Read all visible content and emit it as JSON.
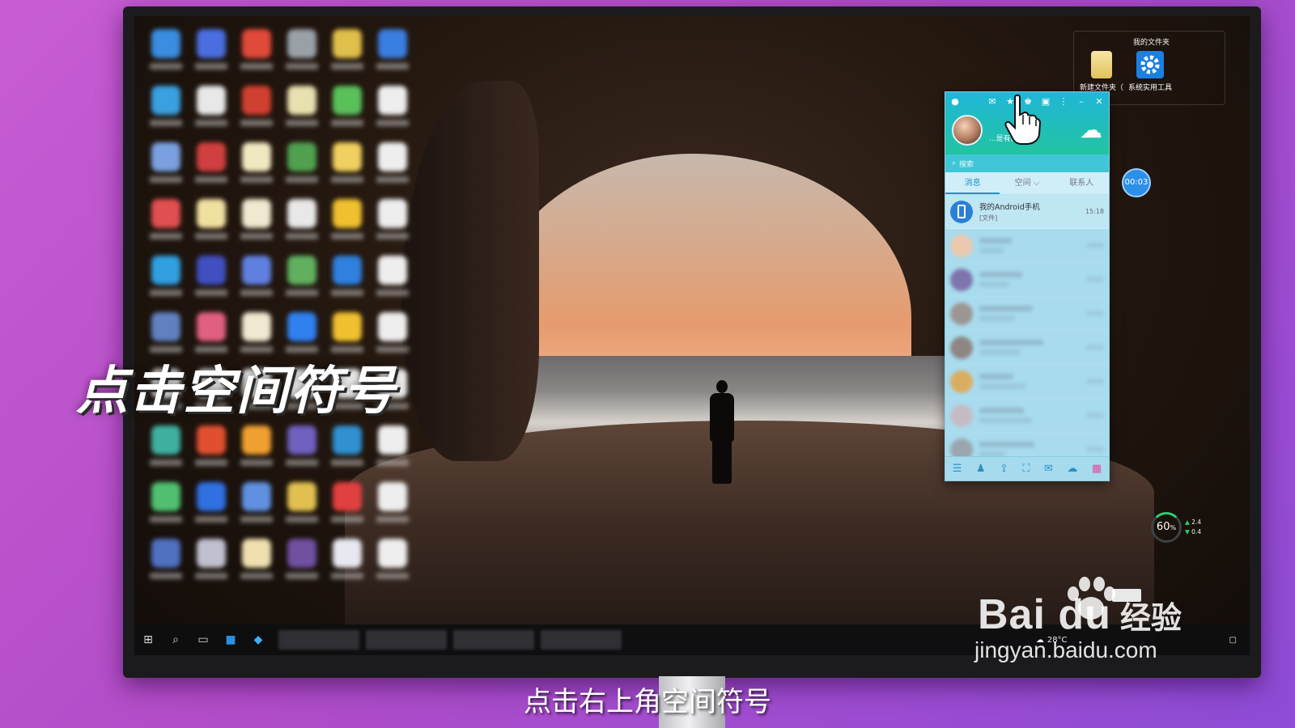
{
  "overlay": {
    "big_caption": "点击空间符号",
    "subtitle": "点击右上角空间符号"
  },
  "desktop_widget": {
    "title": "我的文件夹",
    "items": [
      {
        "label": "新建文件夹（",
        "icon": "folder-icon"
      },
      {
        "label": "系统实用工具",
        "icon": "gear-icon"
      }
    ]
  },
  "qq": {
    "signature": "...是有区别...",
    "search_placeholder": "搜索",
    "tabs": [
      {
        "label": "消息",
        "active": true
      },
      {
        "label": "空间 ⌵",
        "active": false
      },
      {
        "label": "联系人",
        "active": false
      }
    ],
    "conversations": [
      {
        "name": "我的Android手机",
        "subtitle": "[文件]",
        "time": "15:18",
        "blurred": false
      }
    ],
    "blurred_rows": 7,
    "colors": {
      "header_top": "#1fb7d8",
      "header_bottom": "#22c3a1",
      "panel": "#a8dbee",
      "active_tab": "#1f92c9"
    }
  },
  "timer": {
    "text": "00:03"
  },
  "perf": {
    "percent": "60",
    "unit": "%",
    "up": "2.4",
    "down": "0.4"
  },
  "taskbar": {
    "weather": "28°C"
  },
  "watermark": {
    "brand": "Bai du",
    "brand_cn": "经验",
    "url": "jingyan.baidu.com"
  },
  "desktop_icon_colors": [
    "#3a8de0",
    "#4a6ee0",
    "#e04a3a",
    "#9aa0a8",
    "#e0c04a",
    "#3a7ee0",
    "#3aa0e0",
    "#e8e8e8",
    "#d04030",
    "#e8e0b0",
    "#5ac05a",
    "#eee",
    "#7aa0e0",
    "#d04040",
    "#f0e8c0",
    "#50a050",
    "#f0d060",
    "#eee",
    "#e05050",
    "#f0e0a0",
    "#f0e8d0",
    "#e8e8e8",
    "#f0c030",
    "#eee",
    "#30a0e0",
    "#4050c0",
    "#6080e0",
    "#60b060",
    "#3080e0",
    "#eee",
    "#6080c0",
    "#e06080",
    "#f0e8d0",
    "#3080f0",
    "#f0c030",
    "#eee",
    "#eee",
    "#eee",
    "#eee",
    "#eee",
    "#eee",
    "#eee",
    "#40b0a0",
    "#e05030",
    "#f0a030",
    "#7060c0",
    "#3090d0",
    "#eee",
    "#50c070",
    "#3070e0",
    "#6090e0",
    "#e0c050",
    "#e04040",
    "#eee",
    "#5070c0",
    "#c0c0d0",
    "#f0e0b0",
    "#7050a0",
    "#e8e8f0",
    "#eee"
  ]
}
